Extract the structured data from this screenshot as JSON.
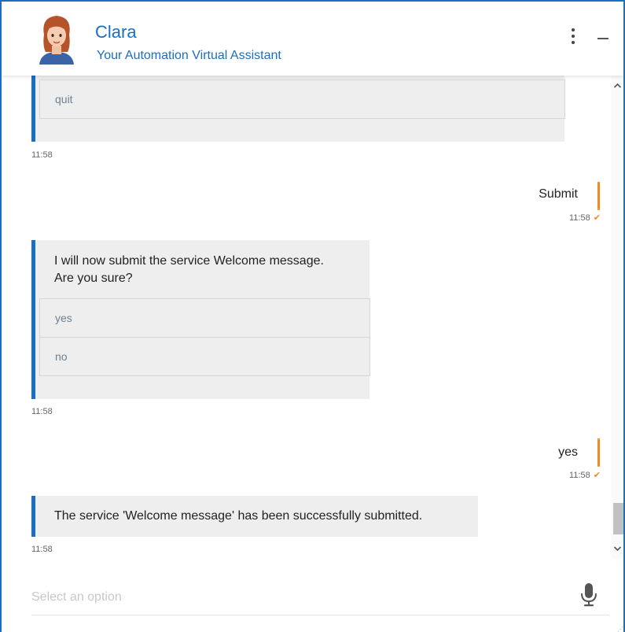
{
  "header": {
    "name": "Clara",
    "subtitle": "Your Automation Virtual Assistant",
    "menu_icon": "vertical-dots-icon",
    "minimize_icon": "minimize-icon"
  },
  "messages": [
    {
      "type": "bot",
      "text": "",
      "options": [
        "quit"
      ],
      "time": "11:58"
    },
    {
      "type": "user",
      "text": "Submit",
      "time": "11:58",
      "status_icon": "check-icon"
    },
    {
      "type": "bot",
      "text_lines": [
        "I will now submit the service Welcome message.",
        "Are you sure?"
      ],
      "options": [
        "yes",
        "no"
      ],
      "time": "11:58"
    },
    {
      "type": "user",
      "text": "yes",
      "time": "11:58",
      "status_icon": "check-icon"
    },
    {
      "type": "bot",
      "text": "The service 'Welcome message' has been successfully submitted.",
      "time": "11:58"
    }
  ],
  "input": {
    "placeholder": "Select an option",
    "value": "",
    "mic_icon": "microphone-icon"
  },
  "colors": {
    "brand": "#1a6fc0",
    "user_accent": "#f08a24",
    "bubble_bg": "#eeeeee"
  }
}
